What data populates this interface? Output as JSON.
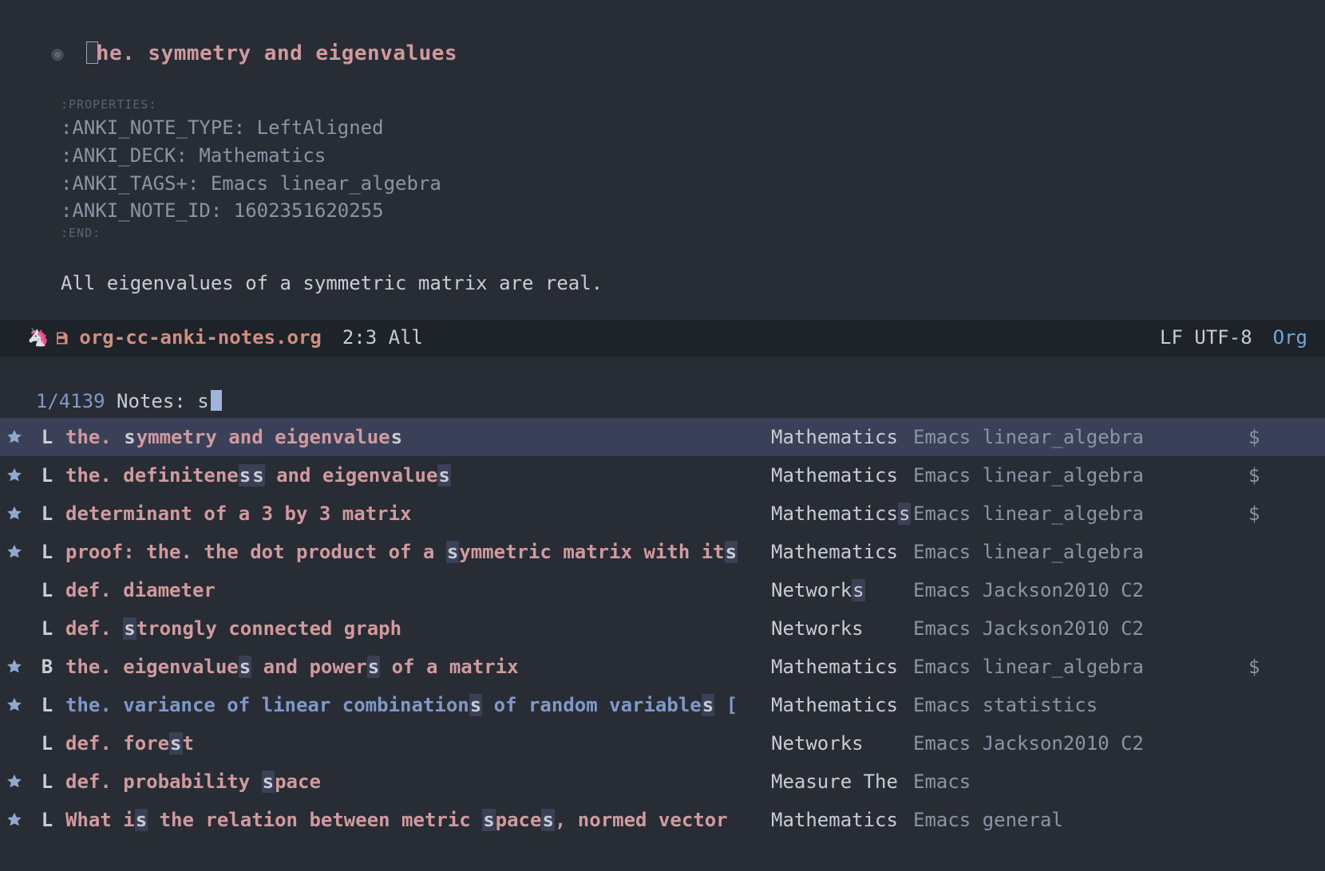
{
  "editor": {
    "title_remainder": "he. symmetry and eigenvalues",
    "properties_open": ":PROPERTIES:",
    "prop_notetype_key": ":ANKI_NOTE_TYPE: ",
    "prop_notetype_val": "LeftAligned",
    "prop_deck_key": ":ANKI_DECK: ",
    "prop_deck_val": "Mathematics",
    "prop_tags_key": ":ANKI_TAGS+: ",
    "prop_tags_val": "Emacs linear_algebra",
    "prop_noteid_key": ":ANKI_NOTE_ID: ",
    "prop_noteid_val": "1602351620255",
    "properties_close": ":END:",
    "body": "All eigenvalues of a symmetric matrix are real."
  },
  "modeline": {
    "filename": "org-cc-anki-notes.org",
    "pos": "2:3 All",
    "encoding": "LF UTF-8",
    "mode": "Org"
  },
  "prompt": {
    "count": "1/4139",
    "label": " Notes: ",
    "query": "s"
  },
  "candidates": [
    {
      "starred": true,
      "type": "L",
      "title_style": "pink",
      "title_parts": [
        "the. ",
        "s",
        "ymmetry and eigenvalue",
        "s",
        ""
      ],
      "deck": "Mathematics",
      "deck_hl": false,
      "tags": "Emacs linear_algebra",
      "extra": "$",
      "selected": true
    },
    {
      "starred": true,
      "type": "L",
      "title_style": "pink",
      "title_parts": [
        "the. definitene",
        "s",
        "",
        "s",
        " and eigenvalue",
        "s",
        ""
      ],
      "deck": "Mathematics",
      "deck_hl": false,
      "tags": "Emacs linear_algebra",
      "extra": "$",
      "selected": false
    },
    {
      "starred": true,
      "type": "L",
      "title_style": "pink",
      "title_parts": [
        "determinant of a 3 by 3 matrix"
      ],
      "deck": "Mathematics",
      "deck_trailing_hl": "s",
      "tags": "Emacs linear_algebra",
      "extra": "$",
      "selected": false
    },
    {
      "starred": true,
      "type": "L",
      "title_style": "pink",
      "title_parts": [
        "proof: the. the dot product of a ",
        "s",
        "ymmetric matrix with it",
        "s",
        ""
      ],
      "deck": "Mathematics",
      "deck_hl": false,
      "tags": "Emacs linear_algebra",
      "extra": "",
      "selected": false
    },
    {
      "starred": false,
      "type": "L",
      "title_style": "pink",
      "title_parts": [
        "def. diameter"
      ],
      "deck": "Network",
      "deck_trailing_hl": "s",
      "tags": "Emacs Jackson2010 C2",
      "extra": "",
      "selected": false
    },
    {
      "starred": false,
      "type": "L",
      "title_style": "pink",
      "title_parts": [
        "def. ",
        "s",
        "trongly connected graph"
      ],
      "deck": "Networks",
      "deck_hl": false,
      "tags": "Emacs Jackson2010 C2",
      "extra": "",
      "selected": false
    },
    {
      "starred": true,
      "type": "B",
      "title_style": "pink",
      "title_parts": [
        "the. eigenvalue",
        "s",
        " and power",
        "s",
        " of a matrix"
      ],
      "deck": "Mathematics",
      "deck_hl": false,
      "tags": "Emacs linear_algebra",
      "extra": "$",
      "selected": false
    },
    {
      "starred": true,
      "type": "L",
      "title_style": "blue",
      "title_parts": [
        "the. variance of linear combination",
        "s",
        " of random variable",
        "s",
        " ["
      ],
      "deck": "Mathematics",
      "deck_hl": false,
      "tags": "Emacs statistics",
      "extra": "",
      "selected": false
    },
    {
      "starred": false,
      "type": "L",
      "title_style": "pink",
      "title_parts": [
        "def. fore",
        "s",
        "t"
      ],
      "deck": "Networks",
      "deck_hl": false,
      "tags": "Emacs Jackson2010 C2",
      "extra": "",
      "selected": false
    },
    {
      "starred": true,
      "type": "L",
      "title_style": "pink",
      "title_parts": [
        "def. probability ",
        "s",
        "pace"
      ],
      "deck": "Measure The",
      "deck_hl": false,
      "tags": "Emacs",
      "extra": "",
      "selected": false
    },
    {
      "starred": true,
      "type": "L",
      "title_style": "pink",
      "title_parts": [
        "What i",
        "s",
        " the relation between metric ",
        "s",
        "pace",
        "s",
        ", normed vector"
      ],
      "deck": "Mathematics",
      "deck_hl": false,
      "tags": "Emacs general",
      "extra": "",
      "selected": false
    }
  ]
}
